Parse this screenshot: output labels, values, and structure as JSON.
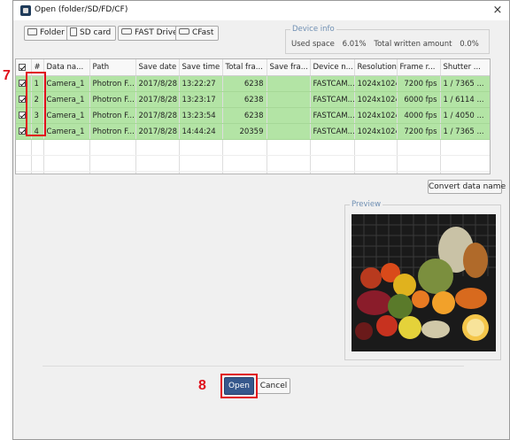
{
  "window": {
    "title": "Open (folder/SD/FD/CF)",
    "close_glyph": "×"
  },
  "toolbar": {
    "buttons": [
      {
        "label": "Folder",
        "icon": "folder-icon"
      },
      {
        "label": "SD card",
        "icon": "sd-card-icon"
      },
      {
        "label": "FAST Drive",
        "icon": "drive-icon"
      },
      {
        "label": "CFast",
        "icon": "drive-icon"
      }
    ]
  },
  "device_info": {
    "title": "Device info",
    "used_space_label": "Used space",
    "used_space_value": "6.01%",
    "total_written_label": "Total written amount",
    "total_written_value": "0.0%"
  },
  "table": {
    "columns": [
      "",
      "#",
      "Data na...",
      "Path",
      "Save date",
      "Save time",
      "Total fra...",
      "Save fra...",
      "Device n...",
      "Resolution",
      "Frame r...",
      "Shutter ..."
    ],
    "header_checked": true,
    "rows": [
      {
        "checked": true,
        "index": "1",
        "data_name": "Camera_1",
        "path": "Photron F...",
        "save_date": "2017/8/28",
        "save_time": "13:22:27",
        "total_frames": "6238",
        "save_frames": "",
        "device_name": "FASTCAM...",
        "resolution": "1024x1024",
        "frame_rate": "7200 fps",
        "shutter": "1 / 7365 ..."
      },
      {
        "checked": true,
        "index": "2",
        "data_name": "Camera_1",
        "path": "Photron F...",
        "save_date": "2017/8/28",
        "save_time": "13:23:17",
        "total_frames": "6238",
        "save_frames": "",
        "device_name": "FASTCAM...",
        "resolution": "1024x1024",
        "frame_rate": "6000 fps",
        "shutter": "1 / 6114 ..."
      },
      {
        "checked": true,
        "index": "3",
        "data_name": "Camera_1",
        "path": "Photron F...",
        "save_date": "2017/8/28",
        "save_time": "13:23:54",
        "total_frames": "6238",
        "save_frames": "",
        "device_name": "FASTCAM...",
        "resolution": "1024x1024",
        "frame_rate": "4000 fps",
        "shutter": "1 / 4050 ..."
      },
      {
        "checked": true,
        "index": "4",
        "data_name": "Camera_1",
        "path": "Photron F...",
        "save_date": "2017/8/28",
        "save_time": "14:44:24",
        "total_frames": "20359",
        "save_frames": "",
        "device_name": "FASTCAM...",
        "resolution": "1024x1024",
        "frame_rate": "7200 fps",
        "shutter": "1 / 7365 ..."
      }
    ]
  },
  "actions": {
    "convert_label": "Convert data name",
    "open_label": "Open",
    "cancel_label": "Cancel"
  },
  "preview": {
    "title": "Preview"
  },
  "callouts": {
    "step_7": "7",
    "step_8": "8"
  },
  "colors": {
    "accent_red": "#e0101a",
    "row_selected_green": "#b3e4a5",
    "primary_button": "#36588c",
    "group_title_blue": "#6f8fb3"
  }
}
